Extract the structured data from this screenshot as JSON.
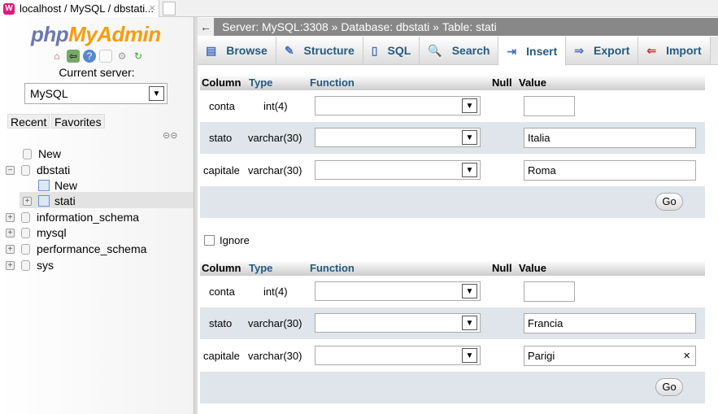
{
  "browser": {
    "tab_title": "localhost / MySQL / dbstati...",
    "close": "×"
  },
  "sidebar": {
    "logo_php": "php",
    "logo_myadmin": "MyAdmin",
    "current_server_label": "Current server:",
    "server_select": "MySQL",
    "recent": "Recent",
    "favorites": "Favorites",
    "tree": [
      {
        "label": "New"
      },
      {
        "label": "dbstati"
      },
      {
        "label": "New"
      },
      {
        "label": "stati"
      },
      {
        "label": "information_schema"
      },
      {
        "label": "mysql"
      },
      {
        "label": "performance_schema"
      },
      {
        "label": "sys"
      }
    ]
  },
  "breadcrumb": {
    "server": "Server: MySQL:3308",
    "sep": "»",
    "database": "Database: dbstati",
    "table": "Table: stati"
  },
  "tabs": [
    {
      "label": "Browse"
    },
    {
      "label": "Structure"
    },
    {
      "label": "SQL"
    },
    {
      "label": "Search"
    },
    {
      "label": "Insert"
    },
    {
      "label": "Export"
    },
    {
      "label": "Import"
    }
  ],
  "headers": {
    "column": "Column",
    "type": "Type",
    "function": "Function",
    "null": "Null",
    "value": "Value"
  },
  "forms": [
    {
      "rows": [
        {
          "column": "conta",
          "type": "int(4)",
          "value": ""
        },
        {
          "column": "stato",
          "type": "varchar(30)",
          "value": "Italia"
        },
        {
          "column": "capitale",
          "type": "varchar(30)",
          "value": "Roma"
        }
      ],
      "go": "Go"
    },
    {
      "rows": [
        {
          "column": "conta",
          "type": "int(4)",
          "value": ""
        },
        {
          "column": "stato",
          "type": "varchar(30)",
          "value": "Francia"
        },
        {
          "column": "capitale",
          "type": "varchar(30)",
          "value": "Parigi"
        }
      ],
      "go": "Go"
    }
  ],
  "ignore_label": "Ignore",
  "clear_icon": "×"
}
